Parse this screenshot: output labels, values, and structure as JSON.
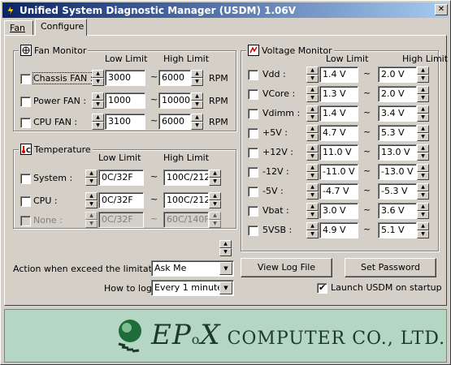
{
  "window": {
    "title": "Unified System Diagnostic Manager (USDM) 1.06V"
  },
  "tabs": [
    {
      "label": "Fan"
    },
    {
      "label": "Configure"
    }
  ],
  "fan_monitor": {
    "title": "Fan Monitor",
    "low_header": "Low Limit",
    "high_header": "High Limit",
    "rows": [
      {
        "label": "Chassis FAN :",
        "low": "3000",
        "high": "6000",
        "unit": "RPM",
        "checked": false
      },
      {
        "label": "Power FAN :",
        "low": "1000",
        "high": "10000",
        "unit": "RPM",
        "checked": false
      },
      {
        "label": "CPU FAN :",
        "low": "3100",
        "high": "6000",
        "unit": "RPM",
        "checked": false
      }
    ],
    "sep": "~"
  },
  "temperature": {
    "title": "Temperature",
    "low_header": "Low Limit",
    "high_header": "High Limit",
    "rows": [
      {
        "label": "System :",
        "low": "0C/32F",
        "high": "100C/212",
        "enabled": true
      },
      {
        "label": "CPU :",
        "low": "0C/32F",
        "high": "100C/212",
        "enabled": true
      },
      {
        "label": "None :",
        "low": "0C/32F",
        "high": "60C/140F",
        "enabled": false
      }
    ]
  },
  "voltage_monitor": {
    "title": "Voltage Monitor",
    "low_header": "Low Limit",
    "high_header": "High Limit",
    "rows": [
      {
        "label": "Vdd :",
        "low": "1.4 V",
        "high": "2.0 V"
      },
      {
        "label": "VCore :",
        "low": "1.3 V",
        "high": "2.0 V"
      },
      {
        "label": "Vdimm :",
        "low": "1.4 V",
        "high": "3.4 V"
      },
      {
        "label": "+5V :",
        "low": "4.7 V",
        "high": "5.3 V"
      },
      {
        "label": "+12V :",
        "low": "11.0 V",
        "high": "13.0 V"
      },
      {
        "label": "-12V :",
        "low": "-11.0 V",
        "high": "-13.0 V"
      },
      {
        "label": "-5V :",
        "low": "-4.7 V",
        "high": "-5.3 V"
      },
      {
        "label": "Vbat :",
        "low": "3.0 V",
        "high": "3.6 V"
      },
      {
        "label": "5VSB :",
        "low": "4.9 V",
        "high": "5.1 V"
      }
    ]
  },
  "action": {
    "label": "Action when exceed the limitations",
    "value": "Ask Me"
  },
  "log": {
    "label": "How to log",
    "value": "Every 1 minute"
  },
  "buttons": {
    "view_log": "View Log File",
    "set_password": "Set Password"
  },
  "launch": {
    "label": "Launch USDM on startup",
    "checked": true
  },
  "banner": {
    "brand_a": "EP",
    "brand_b": "o",
    "brand_c": "X",
    "rest": "COMPUTER CO., LTD."
  }
}
